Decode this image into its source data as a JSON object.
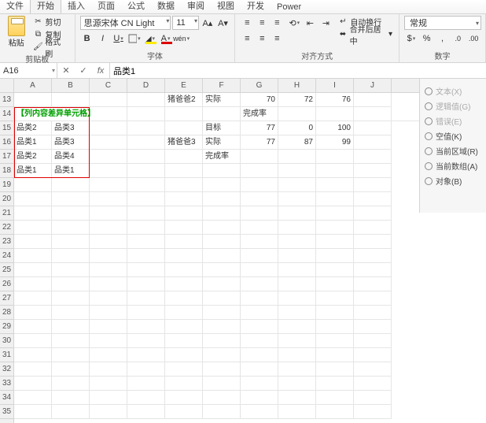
{
  "tabs": [
    "文件",
    "开始",
    "插入",
    "页面",
    "公式",
    "数据",
    "审阅",
    "视图",
    "开发",
    "Power"
  ],
  "active_tab": 1,
  "clipboard": {
    "label": "剪贴板",
    "cut": "剪切",
    "copy": "复制",
    "format": "格式刷",
    "paste": "粘贴"
  },
  "font": {
    "label": "字体",
    "name": "思源宋体 CN Light",
    "size": "11",
    "bold": "B",
    "italic": "I",
    "underline": "U"
  },
  "align": {
    "label": "对齐方式",
    "wrap": "自动换行",
    "merge": "合并后居中"
  },
  "number": {
    "label": "数字",
    "format": "常规"
  },
  "namebox": "A16",
  "formula": "品类1",
  "cols": [
    "A",
    "B",
    "C",
    "D",
    "E",
    "F",
    "G",
    "H",
    "I",
    "J"
  ],
  "rowStart": 13,
  "rowCount": 23,
  "cells": {
    "E13": "猪爸爸2",
    "F13": "实际",
    "G13": "70",
    "H13": "72",
    "I13": "76",
    "A14": "【列内容差异单元格】",
    "F14": "完成率",
    "A15": "品类2",
    "B15": "品类3",
    "F15": "目标",
    "G15": "77",
    "H15": "0",
    "I15": "100",
    "A16": "品类1",
    "B16": "品类3",
    "E16": "猪爸爸3",
    "F16": "实际",
    "G16": "77",
    "H16": "87",
    "I16": "99",
    "A17": "品类2",
    "B17": "品类4",
    "F17": "完成率",
    "A18": "品类1",
    "B18": "品类1"
  },
  "numericCells": [
    "G13",
    "H13",
    "I13",
    "G15",
    "H15",
    "I15",
    "G16",
    "H16",
    "I16"
  ],
  "sidepanel": {
    "opts_gray": [
      "文本(X)",
      "逻辑值(G)",
      "错误(E)"
    ],
    "opts": [
      "空值(K)",
      "当前区域(R)",
      "当前数组(A)",
      "对象(B)"
    ]
  }
}
